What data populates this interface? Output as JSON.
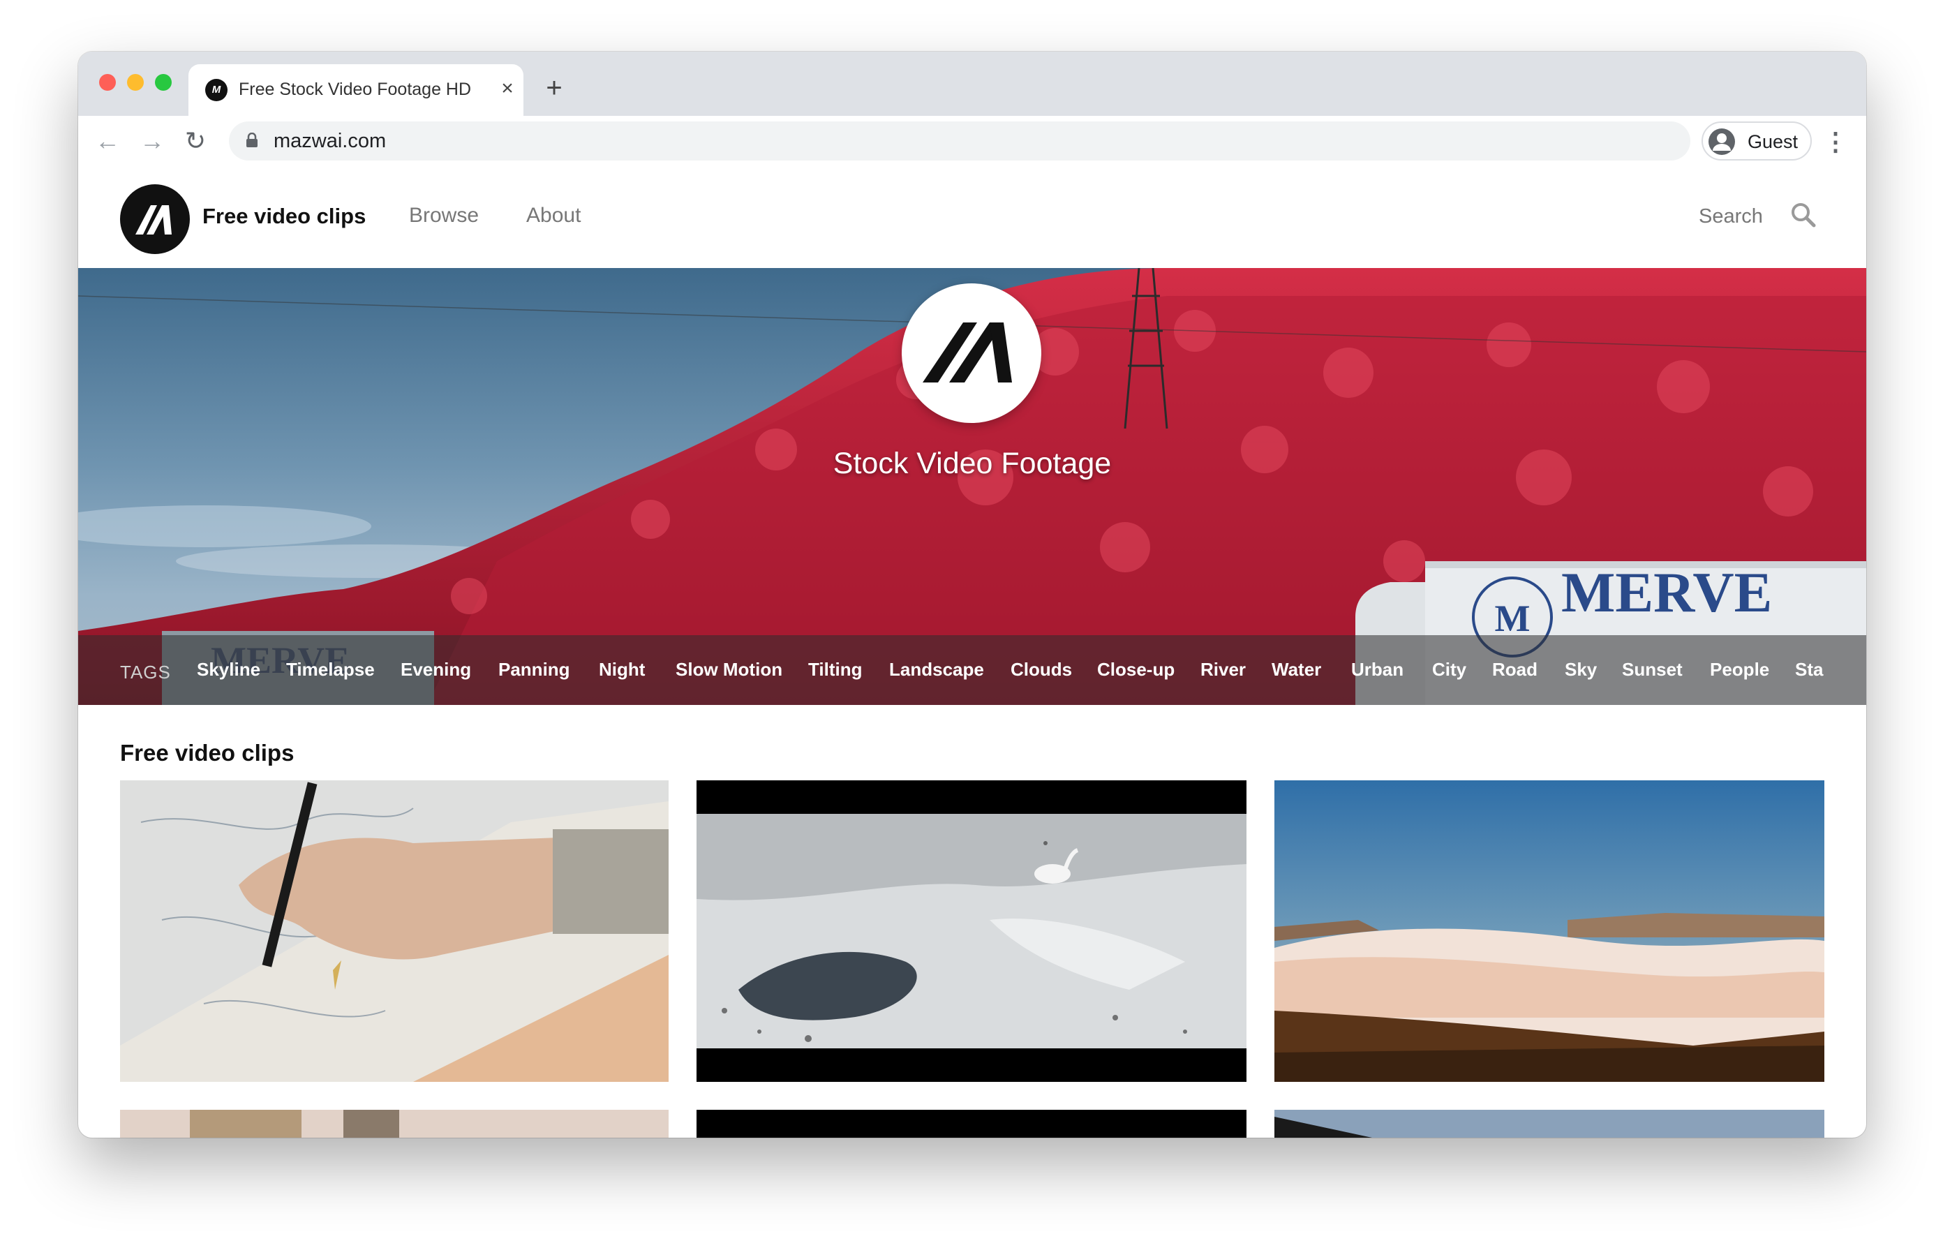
{
  "browser": {
    "tab_title": "Free Stock Video Footage HD F",
    "tab_close": "×",
    "new_tab": "+",
    "url": "mazwai.com",
    "profile_label": "Guest",
    "menu": "⋮",
    "back": "←",
    "forward": "→",
    "reload": "↻"
  },
  "header": {
    "title": "Free video clips",
    "nav": [
      "Browse",
      "About"
    ],
    "search_label": "Search"
  },
  "hero": {
    "title": "Stock Video Footage",
    "truck_text": "MERVE",
    "tags_label": "TAGS",
    "tags": [
      "Skyline",
      "Timelapse",
      "Evening",
      "Panning",
      "Night",
      "Slow Motion",
      "Tilting",
      "Landscape",
      "Clouds",
      "Close-up",
      "River",
      "Water",
      "Urban",
      "City",
      "Road",
      "Sky",
      "Sunset",
      "People",
      "Sta"
    ]
  },
  "content": {
    "section_title": "Free video clips",
    "thumbnails": [
      "hand-drawing-on-map",
      "swan-on-snowy-river",
      "fog-over-canyon-sunset",
      "street-scene",
      "dark-clip",
      "mountain-sky"
    ]
  },
  "colors": {
    "hero_red": "#c8243a",
    "sky_blue": "#5d86a6",
    "brand_black": "#111111",
    "traffic_red": "#fe5f57",
    "traffic_yellow": "#febc2e",
    "traffic_green": "#28c840"
  }
}
